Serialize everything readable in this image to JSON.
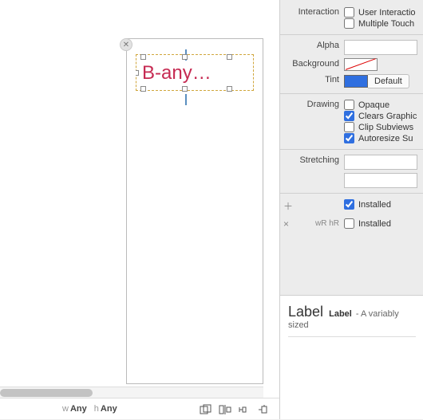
{
  "canvas": {
    "label_text": "B-any…",
    "compact": {
      "w_prefix": "w",
      "w_value": "Any",
      "h_prefix": "h",
      "h_value": "Any"
    }
  },
  "inspector": {
    "interaction": {
      "label": "Interaction",
      "user_interaction": {
        "label": "User Interactio",
        "checked": false
      },
      "multiple_touch": {
        "label": "Multiple Touch",
        "checked": false
      }
    },
    "alpha": {
      "label": "Alpha",
      "value": ""
    },
    "background": {
      "label": "Background",
      "swatch": "clear"
    },
    "tint": {
      "label": "Tint",
      "default_label": "Default",
      "swatch": "#2f6fe0"
    },
    "drawing": {
      "label": "Drawing",
      "opaque": {
        "label": "Opaque",
        "checked": false
      },
      "clears_graphics": {
        "label": "Clears Graphic",
        "checked": true
      },
      "clip_subviews": {
        "label": "Clip Subviews",
        "checked": false
      },
      "autoresize": {
        "label": "Autoresize Su",
        "checked": true
      }
    },
    "stretching": {
      "label": "Stretching",
      "value": ""
    },
    "installed_primary": {
      "label": "Installed",
      "checked": true
    },
    "trait_string": "wR hR",
    "installed_secondary": {
      "label": "Installed",
      "checked": false
    }
  },
  "library": {
    "title": "Label",
    "subtitle": "Label",
    "desc": "- A variably sized"
  }
}
